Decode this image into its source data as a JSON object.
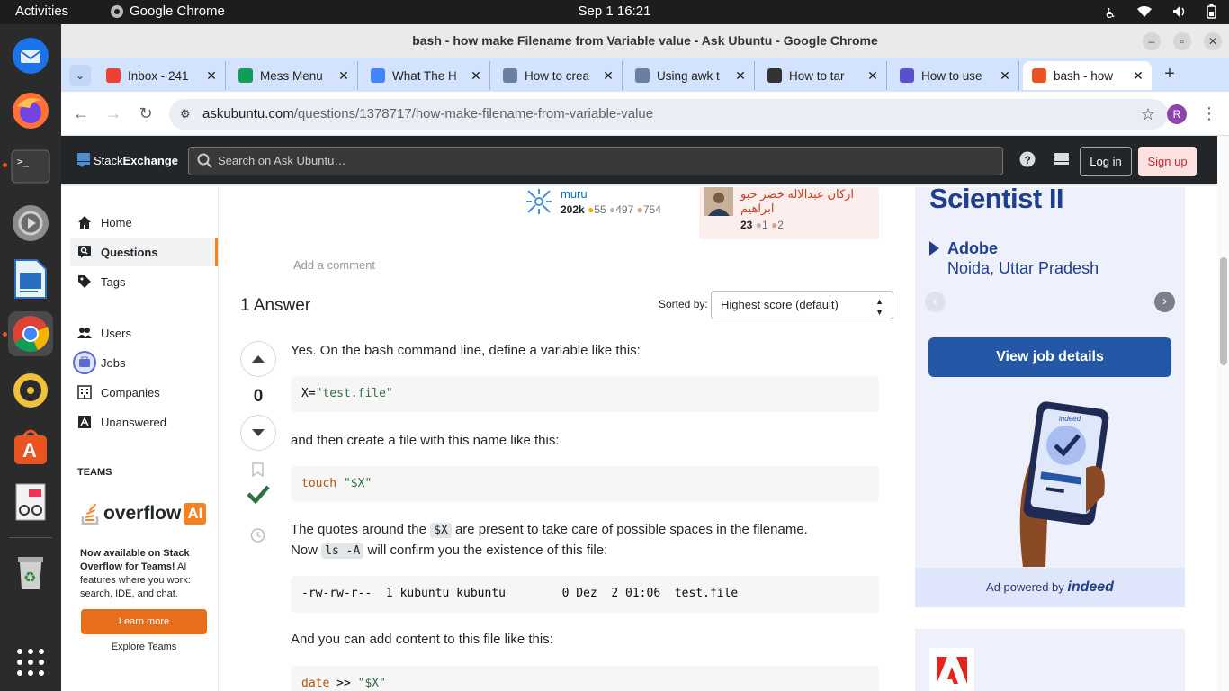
{
  "system": {
    "activities": "Activities",
    "app_name": "Google Chrome",
    "clock": "Sep 1  16:21"
  },
  "window": {
    "title": "bash - how make Filename from Variable value - Ask Ubuntu - Google Chrome"
  },
  "tabs": [
    {
      "label": "Inbox - 241",
      "favicon": "gmail-icon",
      "color": "#ea4335"
    },
    {
      "label": "Mess Menu",
      "favicon": "sheets-icon",
      "color": "#0f9d58"
    },
    {
      "label": "What The H",
      "favicon": "docs-icon",
      "color": "#4285f4"
    },
    {
      "label": "How to crea",
      "favicon": "askubuntu-user-icon",
      "color": "#6b7fa0"
    },
    {
      "label": "Using awk t",
      "favicon": "askubuntu-user-icon",
      "color": "#6b7fa0"
    },
    {
      "label": "How to tar",
      "favicon": "tux-icon",
      "color": "#333333"
    },
    {
      "label": "How to use",
      "favicon": "site-s-icon",
      "color": "#5a4fcf"
    },
    {
      "label": "bash - how",
      "favicon": "askubuntu-icon",
      "color": "#e95420",
      "active": true
    }
  ],
  "omnibox": {
    "domain": "askubuntu.com",
    "path": "/questions/1378717/how-make-filename-from-variable-value"
  },
  "profile_initial": "R",
  "site": {
    "logo_stack": "Stack",
    "logo_exchange": "Exchange",
    "search_placeholder": "Search on Ask Ubuntu…",
    "login": "Log in",
    "signup": "Sign up"
  },
  "leftnav": {
    "items": [
      {
        "label": "Home",
        "icon": "home-icon"
      },
      {
        "label": "Questions",
        "icon": "questions-icon",
        "selected": true
      },
      {
        "label": "Tags",
        "icon": "tag-icon"
      },
      {
        "label": "Users",
        "icon": "users-icon"
      },
      {
        "label": "Jobs",
        "icon": "jobs-icon"
      },
      {
        "label": "Companies",
        "icon": "companies-icon"
      },
      {
        "label": "Unanswered",
        "icon": "unanswered-icon"
      }
    ],
    "teams_heading": "TEAMS",
    "overflow_text": "overflow",
    "overflow_ai": "AI",
    "available_bold": "Now available on Stack Overflow for Teams!",
    "available_rest": " AI features where you work: search, IDE, and chat.",
    "learn_more": "Learn more",
    "explore_teams": "Explore Teams"
  },
  "question_users": {
    "muru": {
      "name": "muru",
      "rep": "202k",
      "gold": "55",
      "silver": "497",
      "bronze": "754"
    },
    "editor": {
      "name": "اركان عبدالاله خضر حبو ابراهيم",
      "rep": "23",
      "silver": "1",
      "bronze": "2"
    }
  },
  "add_comment": "Add a comment",
  "answers": {
    "title": "1 Answer",
    "sorted_by": "Sorted by:",
    "sort_value": "Highest score (default)",
    "vote_count": "0"
  },
  "answer": {
    "p1": "Yes. On the bash command line, define a variable like this:",
    "code1_var": "X=",
    "code1_str": "\"test.file\"",
    "p2": "and then create a file with this name like this:",
    "code2_cmd": "touch",
    "code2_str": "\"$X\"",
    "p3_a": "The quotes around the ",
    "p3_code": "$X",
    "p3_b": " are present to take care of possible spaces in the filename.",
    "p4_a": "Now ",
    "p4_code": "ls -A",
    "p4_b": " will confirm you the existence of this file:",
    "code3": "-rw-rw-r--  1 kubuntu kubuntu        0 Dez  2 01:06  test.file",
    "p5": "And you can add content to this file like this:",
    "code4_cmd": "date",
    "code4_op": " >> ",
    "code4_str": "\"$X\""
  },
  "ad": {
    "job_title": "Scientist II",
    "company": "Adobe",
    "location": "Noida, Uttar Pradesh",
    "cta": "View job details",
    "powered_prefix": "Ad powered by ",
    "powered_brand": "indeed",
    "phone_brand": "indeed",
    "accent": "#2557a7"
  }
}
